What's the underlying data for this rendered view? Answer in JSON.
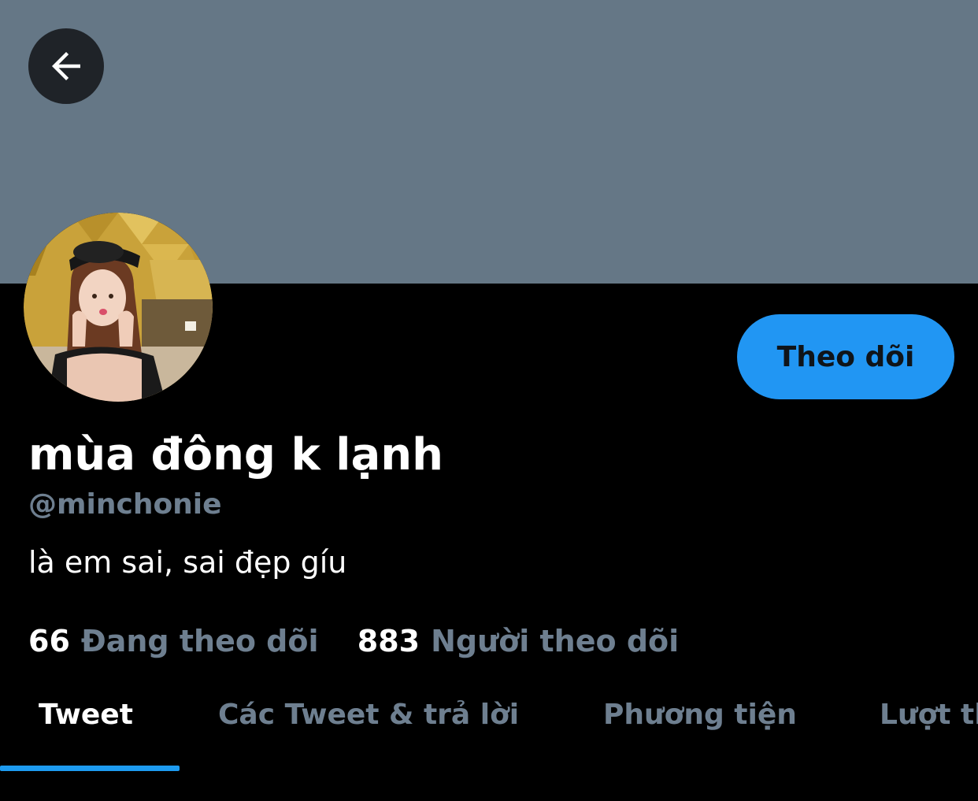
{
  "colors": {
    "banner": "#657786",
    "background": "#000000",
    "accent": "#1d9bf0",
    "follow_button_bg": "#2196f3",
    "secondary_text": "#6e7f90",
    "primary_text": "#ffffff"
  },
  "header": {
    "back_icon": "arrow-left-icon"
  },
  "profile": {
    "display_name": "mùa đông k lạnh",
    "handle": "@minchonie",
    "bio": "là em sai, sai đẹp gíu",
    "follow_label": "Theo dõi",
    "following_count": "66",
    "following_label": "Đang theo dõi",
    "followers_count": "883",
    "followers_label": "Người theo dõi"
  },
  "tabs": [
    {
      "label": "Tweet",
      "active": true
    },
    {
      "label": "Các Tweet & trả lời",
      "active": false
    },
    {
      "label": "Phương tiện",
      "active": false
    },
    {
      "label": "Lượt thích",
      "active": false
    }
  ]
}
